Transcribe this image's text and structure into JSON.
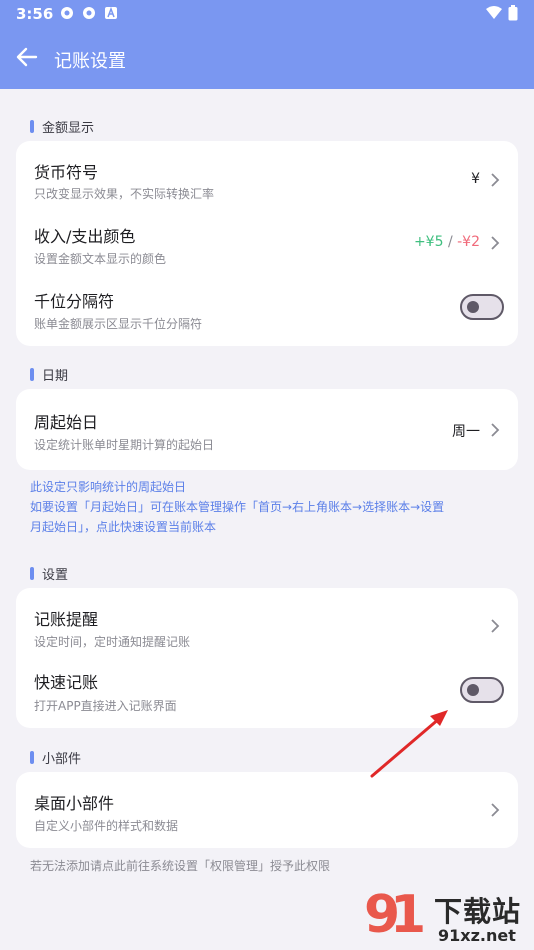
{
  "status": {
    "time": "3:56"
  },
  "appbar": {
    "title": "记账设置"
  },
  "sections": {
    "amount": {
      "label": "金额显示"
    },
    "date": {
      "label": "日期"
    },
    "settings": {
      "label": "设置"
    },
    "widget": {
      "label": "小部件"
    }
  },
  "amount": {
    "currency": {
      "title": "货币符号",
      "sub": "只改变显示效果，不实际转换汇率",
      "value": "¥"
    },
    "color": {
      "title": "收入/支出颜色",
      "sub": "设置金额文本显示的颜色",
      "income": "+¥5",
      "sep": " / ",
      "expense": "-¥2"
    },
    "thousands": {
      "title": "千位分隔符",
      "sub": "账单金额展示区显示千位分隔符"
    }
  },
  "date": {
    "week_start": {
      "title": "周起始日",
      "sub": "设定统计账单时星期计算的起始日",
      "value": "周一"
    },
    "note_line1": "此设定只影响统计的周起始日",
    "note_line2": "如要设置「月起始日」可在账本管理操作「首页→右上角账本→选择账本→设置",
    "note_line3": "月起始日」，点此快速设置当前账本"
  },
  "settings": {
    "reminder": {
      "title": "记账提醒",
      "sub": "设定时间，定时通知提醒记账"
    },
    "quick": {
      "title": "快速记账",
      "sub": "打开APP直接进入记账界面"
    }
  },
  "widget": {
    "desktop": {
      "title": "桌面小部件",
      "sub": "自定义小部件的样式和数据"
    },
    "footnote": "若无法添加请点此前往系统设置「权限管理」授予此权限"
  },
  "watermark": {
    "brand": "下载站",
    "domain": "91xz.net"
  },
  "colors": {
    "accent": "#7a97f1",
    "income": "#3fbf7f",
    "expense": "#f06a7a",
    "annotation_arrow": "#e02828"
  },
  "toggles": {
    "thousands": false,
    "quick": false
  }
}
